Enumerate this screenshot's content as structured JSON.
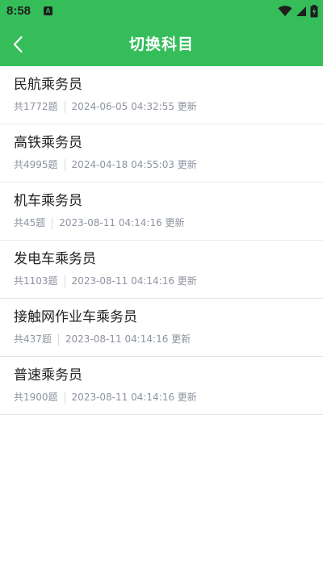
{
  "status_bar": {
    "time": "8:58",
    "app_icon_letter": "A"
  },
  "header": {
    "title": "切换科目"
  },
  "subjects": [
    {
      "name": "民航乘务员",
      "count": "共1772题",
      "updated": "2024-06-05 04:32:55 更新"
    },
    {
      "name": "高铁乘务员",
      "count": "共4995题",
      "updated": "2024-04-18 04:55:03 更新"
    },
    {
      "name": "机车乘务员",
      "count": "共45题",
      "updated": "2023-08-11 04:14:16 更新"
    },
    {
      "name": "发电车乘务员",
      "count": "共1103题",
      "updated": "2023-08-11 04:14:16 更新"
    },
    {
      "name": "接触网作业车乘务员",
      "count": "共437题",
      "updated": "2023-08-11 04:14:16 更新"
    },
    {
      "name": "普速乘务员",
      "count": "共1900题",
      "updated": "2023-08-11 04:14:16 更新"
    }
  ],
  "colors": {
    "header_bg": "#35bd5a",
    "title_text": "#ffffff",
    "meta_text": "#8d93a0",
    "divider": "#e6e6e6"
  },
  "icons": {
    "back": "chevron-left-icon",
    "wifi": "wifi-icon",
    "signal": "cellular-signal-icon",
    "battery": "battery-charging-icon"
  }
}
